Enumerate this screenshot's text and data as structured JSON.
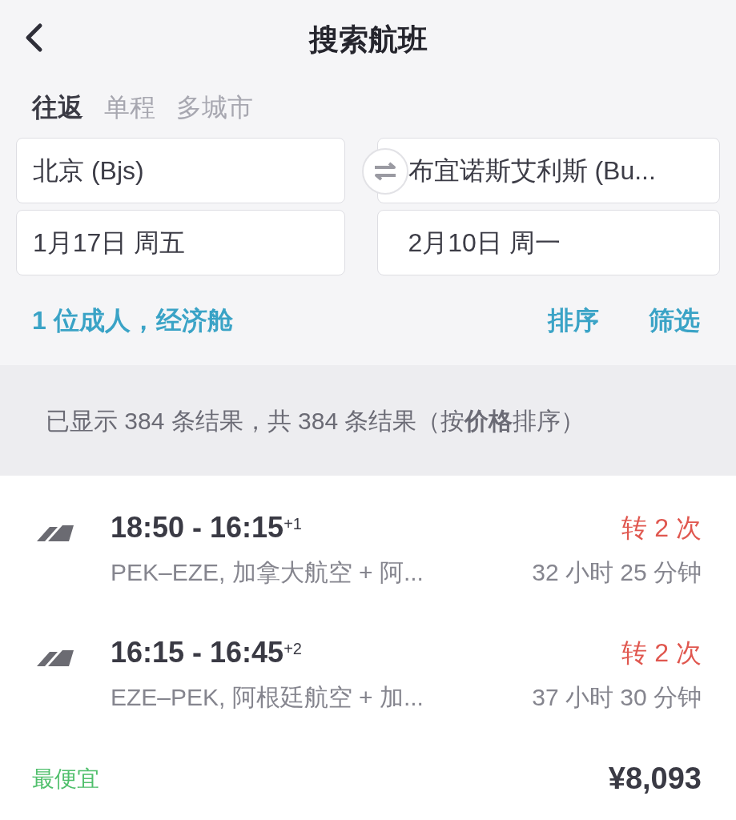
{
  "header": {
    "title": "搜索航班"
  },
  "trip_tabs": [
    {
      "label": "往返",
      "selected": true
    },
    {
      "label": "单程",
      "selected": false
    },
    {
      "label": "多城市",
      "selected": false
    }
  ],
  "route": {
    "from": "北京 (Bjs)",
    "to": "布宜诺斯艾利斯 (Bu..."
  },
  "dates": {
    "depart": "1月17日 周五",
    "return": "2月10日 周一"
  },
  "passengers": "1 位成人，经济舱",
  "actions": [
    "排序",
    "筛选"
  ],
  "summary": "已显示 384 条结果，共 384 条结果（按**价格**排序）",
  "flights": [
    {
      "time": "18:50 - 16:15$^{+1}$",
      "stops": "转 2 次",
      "route": "PEK–EZE, 加拿大航空 + 阿...",
      "duration": "32 小时 25 分钟"
    },
    {
      "time": "16:15 - 16:45$^{+2}$",
      "stops": "转 2 次",
      "route": "EZE–PEK, 阿根廷航空 + 加...",
      "duration": "37 小时 30 分钟"
    }
  ],
  "offer": {
    "tag": "最便宜",
    "price": "¥8,093"
  }
}
